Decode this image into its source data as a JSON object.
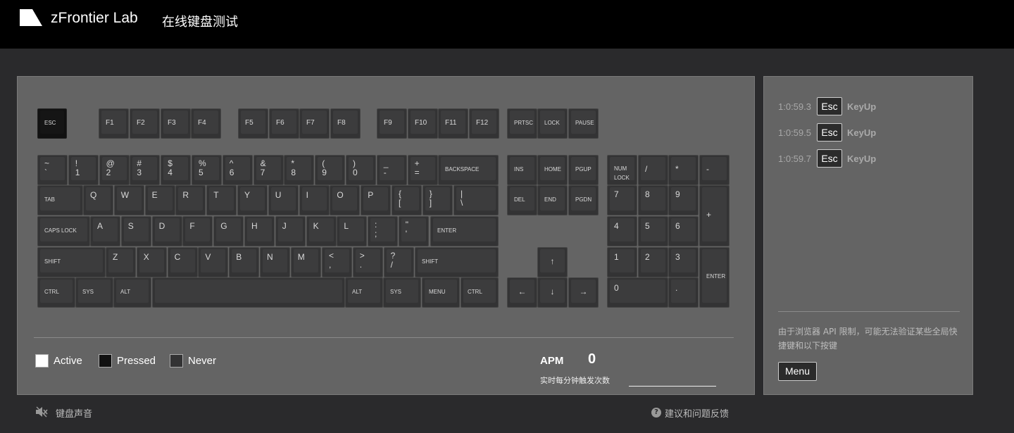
{
  "header": {
    "brand": "zFrontier Lab",
    "subtitle": "在线键盘测试"
  },
  "keyboard": {
    "esc": "ESC",
    "function_keys": [
      "F1",
      "F2",
      "F3",
      "F4",
      "F5",
      "F6",
      "F7",
      "F8",
      "F9",
      "F10",
      "F11",
      "F12"
    ],
    "sys_keys": [
      "PRTSC",
      "LOCK",
      "PAUSE"
    ],
    "number_row": [
      [
        "~",
        "`"
      ],
      [
        "!",
        "1"
      ],
      [
        "@",
        "2"
      ],
      [
        "#",
        "3"
      ],
      [
        "$",
        "4"
      ],
      [
        "%",
        "5"
      ],
      [
        "^",
        "6"
      ],
      [
        "&",
        "7"
      ],
      [
        "*",
        "8"
      ],
      [
        "(",
        "9"
      ],
      [
        ")",
        "0"
      ],
      [
        "_",
        "-"
      ],
      [
        "+",
        "="
      ]
    ],
    "backspace": "BACKSPACE",
    "tab": "TAB",
    "qwerty_row": [
      "Q",
      "W",
      "E",
      "R",
      "T",
      "Y",
      "U",
      "I",
      "O",
      "P"
    ],
    "bracket_keys": [
      [
        "{",
        "["
      ],
      [
        "}",
        "]"
      ],
      [
        "|",
        "\\"
      ]
    ],
    "caps": "CAPS LOCK",
    "home_row": [
      "A",
      "S",
      "D",
      "F",
      "G",
      "H",
      "J",
      "K",
      "L"
    ],
    "home_punct": [
      [
        ":",
        ";"
      ],
      [
        "\"",
        "'"
      ]
    ],
    "enter": "ENTER",
    "shift_left": "SHIFT",
    "bottom_row": [
      "Z",
      "X",
      "C",
      "V",
      "B",
      "N",
      "M"
    ],
    "bottom_punct": [
      [
        "<",
        ","
      ],
      [
        ">",
        "."
      ],
      [
        "?",
        "/"
      ]
    ],
    "shift_right": "SHIFT",
    "mod_left": [
      "CTRL",
      "SYS",
      "ALT"
    ],
    "mod_right": [
      "ALT",
      "SYS",
      "MENU",
      "CTRL"
    ],
    "nav_top": [
      "INS",
      "HOME",
      "PGUP"
    ],
    "nav_bottom": [
      "DEL",
      "END",
      "PGDN"
    ],
    "arrows": {
      "up": "↑",
      "left": "←",
      "down": "↓",
      "right": "→"
    },
    "numpad": {
      "numlock": "NUM\nLOCK",
      "divide": "/",
      "multiply": "*",
      "minus": "-",
      "row7": [
        "7",
        "8",
        "9"
      ],
      "plus": "+",
      "row4": [
        "4",
        "5",
        "6"
      ],
      "row1": [
        "1",
        "2",
        "3"
      ],
      "enter": "ENTER",
      "zero": "0",
      "dot": "."
    }
  },
  "legend": {
    "active": "Active",
    "pressed": "Pressed",
    "never": "Never",
    "active_color": "#ffffff",
    "pressed_color": "#111111",
    "never_color": "#333334"
  },
  "apm": {
    "label": "APM",
    "value": "0",
    "sub": "实时每分钟触发次数"
  },
  "log": [
    {
      "time": "1:0:59.3",
      "key": "Esc",
      "event": "KeyUp"
    },
    {
      "time": "1:0:59.5",
      "key": "Esc",
      "event": "KeyUp"
    },
    {
      "time": "1:0:59.7",
      "key": "Esc",
      "event": "KeyUp"
    }
  ],
  "side": {
    "note": "由于浏览器 API 限制，可能无法验证某些全局快捷键和以下按键",
    "menu": "Menu"
  },
  "footer": {
    "sound": "键盘声音",
    "feedback": "建议和问题反馈"
  }
}
